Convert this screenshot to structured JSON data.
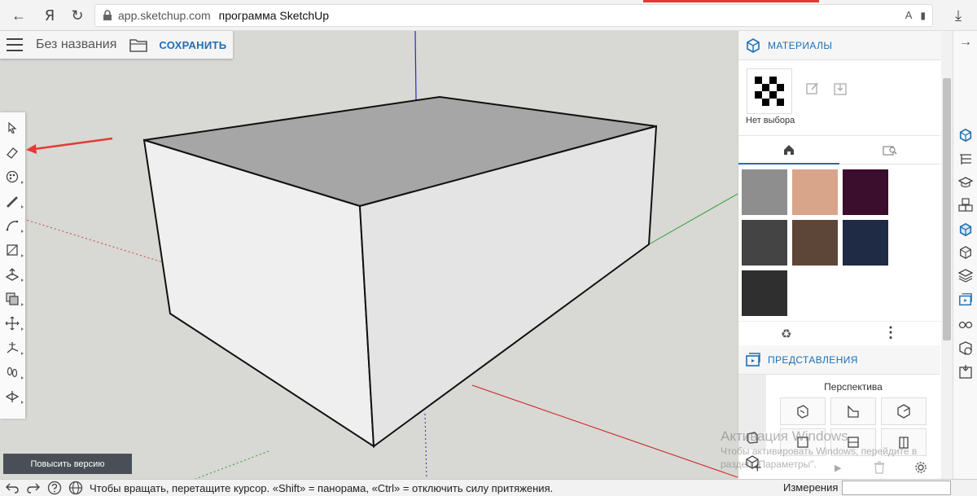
{
  "browser": {
    "url_host": "app.sketchup.com",
    "page_title": "программа SketchUp",
    "nav_back": "←",
    "nav_yandex": "Я",
    "nav_reload": "↻",
    "download": "⤓",
    "side_arrow": "→",
    "translate": "A",
    "bookmark": "▮"
  },
  "app": {
    "doc_title": "Без названия",
    "save_label": "СОХРАНИТЬ",
    "upgrade_label": "Повысить версию"
  },
  "materials": {
    "title": "МАТЕРИАЛЫ",
    "selection_label": "Нет выбора",
    "swatch_colors": [
      "#8e8e8e",
      "#d9a58a",
      "#3a0e2c",
      "#444444",
      "#5d4637",
      "#1f2a44",
      "#2f2f2f"
    ],
    "recycle": "♻",
    "more": "⋮"
  },
  "views": {
    "title": "ПРЕДСТАВЛЕНИЯ",
    "subtitle": "Перспектива",
    "play": "▶"
  },
  "watermark": {
    "title": "Активация Windows",
    "line1": "Чтобы активировать Windows, перейдите в",
    "line2": "раздел \"Параметры\"."
  },
  "status": {
    "hint": "Чтобы вращать, перетащите курсор. «Shift» = панорама, «Ctrl» = отключить силу притяжения.",
    "measure_label": "Измерения",
    "measure_value": ""
  },
  "colors": {
    "accent": "#1e6fb5",
    "arrow": "#e53935"
  }
}
